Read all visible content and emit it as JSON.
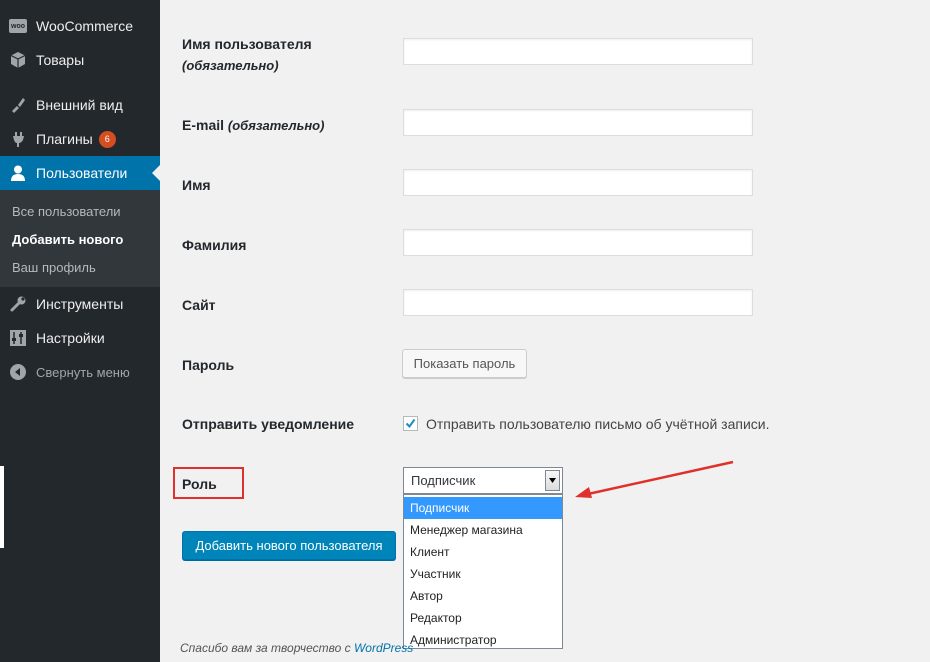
{
  "sidebar": {
    "items": [
      {
        "label": "WooCommerce",
        "icon": "woocommerce-icon",
        "icon_text": "woo"
      },
      {
        "label": "Товары",
        "icon": "products-icon"
      },
      {
        "label": "Внешний вид",
        "icon": "appearance-icon"
      },
      {
        "label": "Плагины",
        "icon": "plugins-icon",
        "badge": "6"
      },
      {
        "label": "Пользователи",
        "icon": "users-icon"
      },
      {
        "label": "Инструменты",
        "icon": "tools-icon"
      },
      {
        "label": "Настройки",
        "icon": "settings-icon"
      }
    ],
    "submenu": [
      "Все пользователи",
      "Добавить нового",
      "Ваш профиль"
    ],
    "collapse_label": "Свернуть меню"
  },
  "form": {
    "username_label": "Имя пользователя",
    "username_required": "(обязательно)",
    "email_label": "E-mail",
    "email_required": "(обязательно)",
    "first_name_label": "Имя",
    "last_name_label": "Фамилия",
    "website_label": "Сайт",
    "password_label": "Пароль",
    "show_password_button": "Показать пароль",
    "notify_label": "Отправить уведомление",
    "notify_checkbox_label": "Отправить пользователю письмо об учётной записи.",
    "notify_checked": true,
    "role_label": "Роль",
    "role_selected": "Подписчик",
    "role_options": [
      "Подписчик",
      "Менеджер магазина",
      "Клиент",
      "Участник",
      "Автор",
      "Редактор",
      "Администратор"
    ],
    "submit_button": "Добавить нового пользователя"
  },
  "footer": {
    "text": "Спасибо вам за творчество с ",
    "link": "WordPress"
  },
  "colors": {
    "sidebar_bg": "#23282d",
    "accent": "#0073aa",
    "badge": "#d54e21",
    "highlight_red": "#e0302b",
    "option_selected": "#3399ff"
  }
}
